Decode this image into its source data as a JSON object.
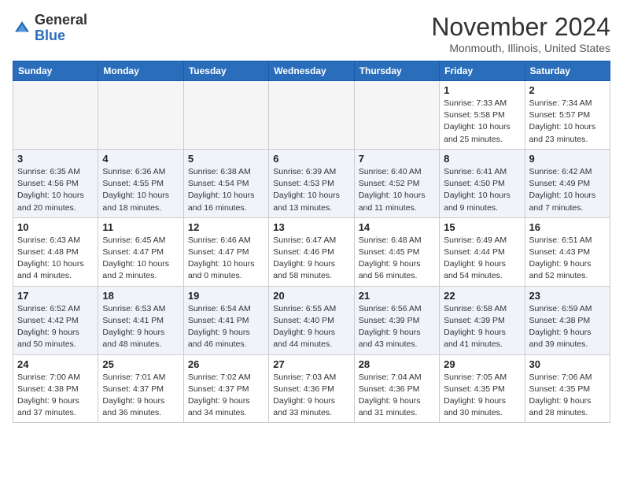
{
  "header": {
    "logo_line1": "General",
    "logo_line2": "Blue",
    "month_title": "November 2024",
    "subtitle": "Monmouth, Illinois, United States"
  },
  "weekdays": [
    "Sunday",
    "Monday",
    "Tuesday",
    "Wednesday",
    "Thursday",
    "Friday",
    "Saturday"
  ],
  "weeks": [
    [
      {
        "day": "",
        "info": ""
      },
      {
        "day": "",
        "info": ""
      },
      {
        "day": "",
        "info": ""
      },
      {
        "day": "",
        "info": ""
      },
      {
        "day": "",
        "info": ""
      },
      {
        "day": "1",
        "info": "Sunrise: 7:33 AM\nSunset: 5:58 PM\nDaylight: 10 hours\nand 25 minutes."
      },
      {
        "day": "2",
        "info": "Sunrise: 7:34 AM\nSunset: 5:57 PM\nDaylight: 10 hours\nand 23 minutes."
      }
    ],
    [
      {
        "day": "3",
        "info": "Sunrise: 6:35 AM\nSunset: 4:56 PM\nDaylight: 10 hours\nand 20 minutes."
      },
      {
        "day": "4",
        "info": "Sunrise: 6:36 AM\nSunset: 4:55 PM\nDaylight: 10 hours\nand 18 minutes."
      },
      {
        "day": "5",
        "info": "Sunrise: 6:38 AM\nSunset: 4:54 PM\nDaylight: 10 hours\nand 16 minutes."
      },
      {
        "day": "6",
        "info": "Sunrise: 6:39 AM\nSunset: 4:53 PM\nDaylight: 10 hours\nand 13 minutes."
      },
      {
        "day": "7",
        "info": "Sunrise: 6:40 AM\nSunset: 4:52 PM\nDaylight: 10 hours\nand 11 minutes."
      },
      {
        "day": "8",
        "info": "Sunrise: 6:41 AM\nSunset: 4:50 PM\nDaylight: 10 hours\nand 9 minutes."
      },
      {
        "day": "9",
        "info": "Sunrise: 6:42 AM\nSunset: 4:49 PM\nDaylight: 10 hours\nand 7 minutes."
      }
    ],
    [
      {
        "day": "10",
        "info": "Sunrise: 6:43 AM\nSunset: 4:48 PM\nDaylight: 10 hours\nand 4 minutes."
      },
      {
        "day": "11",
        "info": "Sunrise: 6:45 AM\nSunset: 4:47 PM\nDaylight: 10 hours\nand 2 minutes."
      },
      {
        "day": "12",
        "info": "Sunrise: 6:46 AM\nSunset: 4:47 PM\nDaylight: 10 hours\nand 0 minutes."
      },
      {
        "day": "13",
        "info": "Sunrise: 6:47 AM\nSunset: 4:46 PM\nDaylight: 9 hours\nand 58 minutes."
      },
      {
        "day": "14",
        "info": "Sunrise: 6:48 AM\nSunset: 4:45 PM\nDaylight: 9 hours\nand 56 minutes."
      },
      {
        "day": "15",
        "info": "Sunrise: 6:49 AM\nSunset: 4:44 PM\nDaylight: 9 hours\nand 54 minutes."
      },
      {
        "day": "16",
        "info": "Sunrise: 6:51 AM\nSunset: 4:43 PM\nDaylight: 9 hours\nand 52 minutes."
      }
    ],
    [
      {
        "day": "17",
        "info": "Sunrise: 6:52 AM\nSunset: 4:42 PM\nDaylight: 9 hours\nand 50 minutes."
      },
      {
        "day": "18",
        "info": "Sunrise: 6:53 AM\nSunset: 4:41 PM\nDaylight: 9 hours\nand 48 minutes."
      },
      {
        "day": "19",
        "info": "Sunrise: 6:54 AM\nSunset: 4:41 PM\nDaylight: 9 hours\nand 46 minutes."
      },
      {
        "day": "20",
        "info": "Sunrise: 6:55 AM\nSunset: 4:40 PM\nDaylight: 9 hours\nand 44 minutes."
      },
      {
        "day": "21",
        "info": "Sunrise: 6:56 AM\nSunset: 4:39 PM\nDaylight: 9 hours\nand 43 minutes."
      },
      {
        "day": "22",
        "info": "Sunrise: 6:58 AM\nSunset: 4:39 PM\nDaylight: 9 hours\nand 41 minutes."
      },
      {
        "day": "23",
        "info": "Sunrise: 6:59 AM\nSunset: 4:38 PM\nDaylight: 9 hours\nand 39 minutes."
      }
    ],
    [
      {
        "day": "24",
        "info": "Sunrise: 7:00 AM\nSunset: 4:38 PM\nDaylight: 9 hours\nand 37 minutes."
      },
      {
        "day": "25",
        "info": "Sunrise: 7:01 AM\nSunset: 4:37 PM\nDaylight: 9 hours\nand 36 minutes."
      },
      {
        "day": "26",
        "info": "Sunrise: 7:02 AM\nSunset: 4:37 PM\nDaylight: 9 hours\nand 34 minutes."
      },
      {
        "day": "27",
        "info": "Sunrise: 7:03 AM\nSunset: 4:36 PM\nDaylight: 9 hours\nand 33 minutes."
      },
      {
        "day": "28",
        "info": "Sunrise: 7:04 AM\nSunset: 4:36 PM\nDaylight: 9 hours\nand 31 minutes."
      },
      {
        "day": "29",
        "info": "Sunrise: 7:05 AM\nSunset: 4:35 PM\nDaylight: 9 hours\nand 30 minutes."
      },
      {
        "day": "30",
        "info": "Sunrise: 7:06 AM\nSunset: 4:35 PM\nDaylight: 9 hours\nand 28 minutes."
      }
    ]
  ]
}
